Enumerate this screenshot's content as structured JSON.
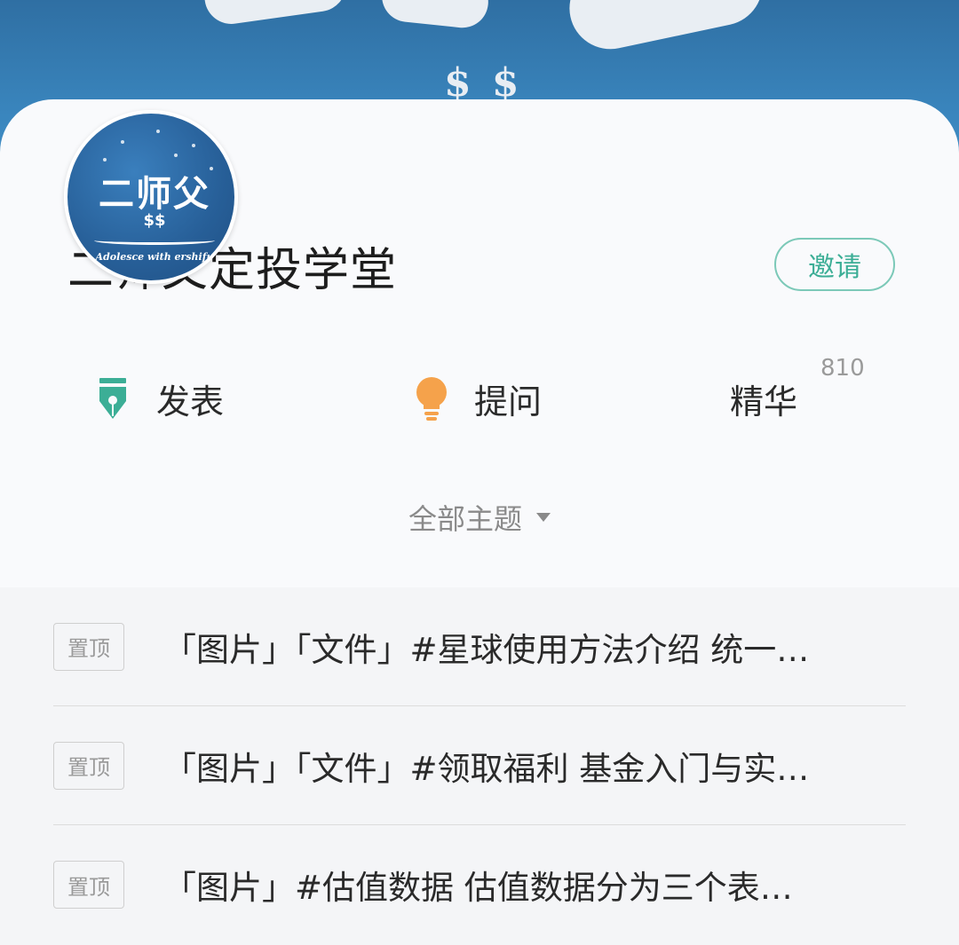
{
  "banner": {
    "symbol": "$ $"
  },
  "avatar": {
    "title": "二师父",
    "dollars": "$$",
    "subtitle": "Adolesce with ershifu"
  },
  "header": {
    "title": "二师父定投学堂",
    "invite_label": "邀请"
  },
  "actions": {
    "post_label": "发表",
    "post_icon": "pen-nib-icon",
    "ask_label": "提问",
    "ask_icon": "lightbulb-icon",
    "best_label": "精华",
    "best_count": "810"
  },
  "filter": {
    "label": "全部主题"
  },
  "posts": [
    {
      "tag": "置顶",
      "text": "「图片」「文件」#星球使用方法介绍  统一…"
    },
    {
      "tag": "置顶",
      "text": "「图片」「文件」#领取福利  基金入门与实…"
    },
    {
      "tag": "置顶",
      "text": "「图片」#估值数据   估值数据分为三个表…"
    }
  ],
  "colors": {
    "accent": "#3cae96",
    "bulb": "#f5a24b",
    "banner": "#3a86be"
  }
}
